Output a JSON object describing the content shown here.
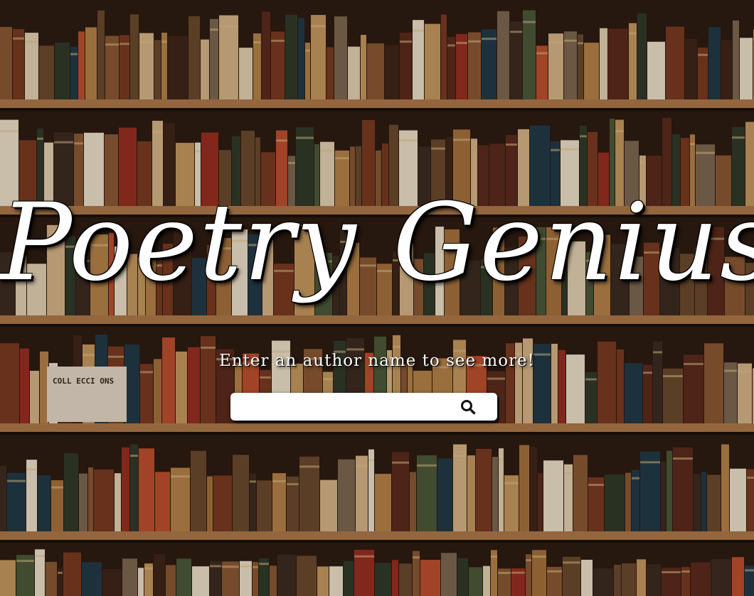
{
  "page": {
    "title": "Poetry Genius",
    "subtitle": "Enter an author name to see more!"
  },
  "search": {
    "value": "",
    "placeholder": "",
    "icon": "search-icon"
  },
  "background": {
    "description_icon": "bookshelf-image",
    "shelf_color": "#b07a4a",
    "wall_color": "#2a1a12"
  },
  "book_cover": {
    "text": "COLL ECCI ONS"
  }
}
